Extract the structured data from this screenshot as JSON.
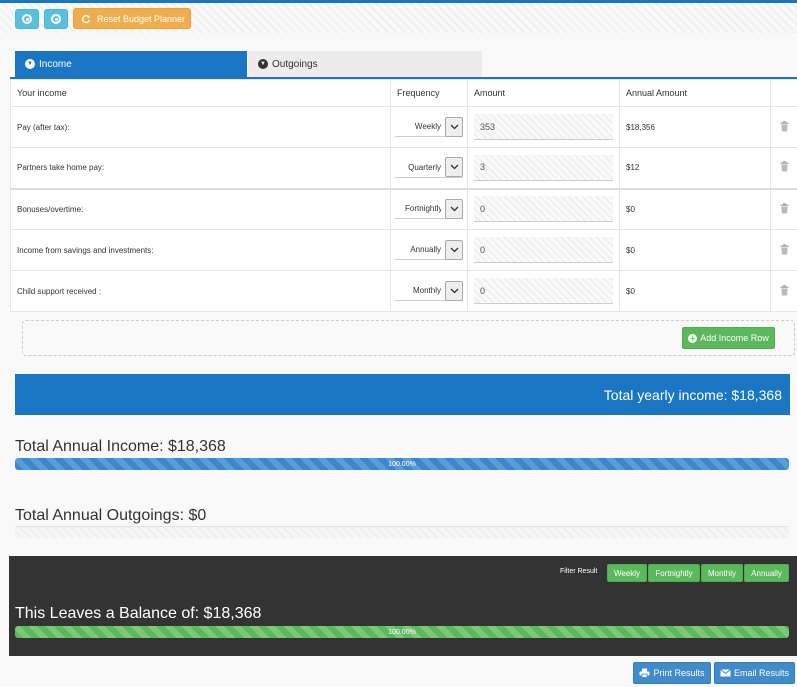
{
  "toolbar": {
    "reset_label": "Reset Budget Planner"
  },
  "tabs": {
    "income": "Income",
    "outgoings": "Outgoings"
  },
  "table": {
    "headers": [
      "Your income",
      "Frequency",
      "Amount",
      "Annual Amount"
    ],
    "rows": [
      {
        "label": "Pay (after tax):",
        "frequency": "Weekly",
        "amount": "353",
        "annual": "$18,356"
      },
      {
        "label": "Partners take home pay:",
        "frequency": "Quarterly",
        "amount": "3",
        "annual": "$12"
      },
      {
        "label": "Bonuses/overtime:",
        "frequency": "Fortnightly",
        "amount": "0",
        "annual": "$0"
      },
      {
        "label": "Income from savings and investments:",
        "frequency": "Annually",
        "amount": "0",
        "annual": "$0"
      },
      {
        "label": "Child support received :",
        "frequency": "Monthly",
        "amount": "0",
        "annual": "$0"
      }
    ]
  },
  "add_row_label": "Add Income Row",
  "total_yearly": "Total yearly income: $18,368",
  "summary": {
    "income_title": "Total Annual Income: $18,368",
    "income_percent_label": "100.00%",
    "income_progress": 1.0,
    "outgoings_title": "Total Annual Outgoings: $0",
    "outgoings_progress": 0
  },
  "balance": {
    "filter_label": "Filter Result",
    "filters": [
      "Weekly",
      "Fortnightly",
      "Monthly",
      "Annually"
    ],
    "title": "This Leaves a Balance of: $18,368",
    "percent_label": "100.00%",
    "progress": 1.0
  },
  "actions": {
    "print": "Print Results",
    "email": "Email Results"
  },
  "colors": {
    "primary": "#1a75c2",
    "success": "#5cb85c",
    "info": "#5bc0de",
    "warning": "#f0ad4e",
    "dark_panel": "#333333"
  },
  "icons": {
    "toolbar_1": "collapse-circle-icon",
    "toolbar_2": "expand-circle-icon",
    "reset": "refresh-icon",
    "row_delete": "trash-icon",
    "add_row": "plus-circle-icon",
    "print": "print-icon",
    "email": "envelope-icon"
  }
}
